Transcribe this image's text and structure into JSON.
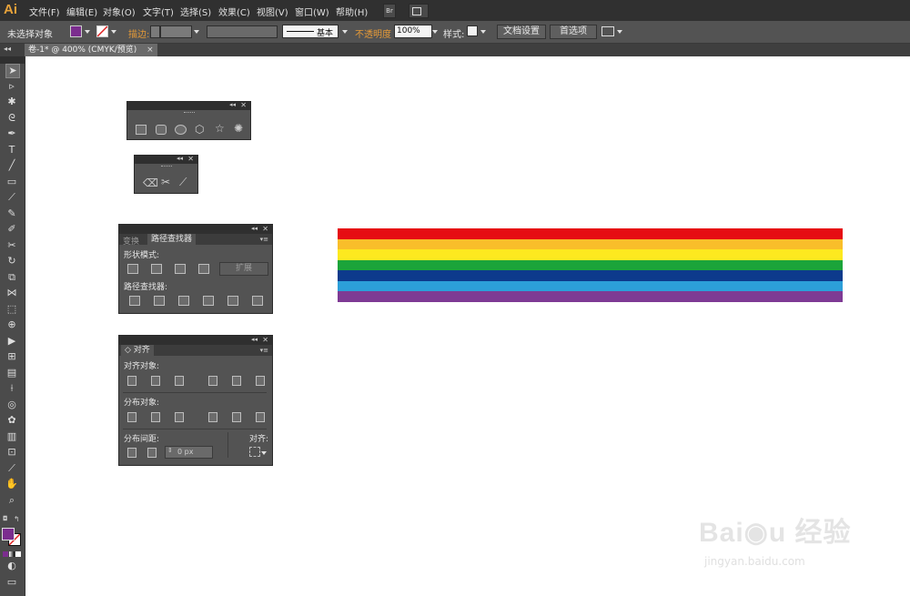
{
  "app": {
    "logo": "Ai"
  },
  "menu": [
    "文件(F)",
    "编辑(E)",
    "对象(O)",
    "文字(T)",
    "选择(S)",
    "效果(C)",
    "视图(V)",
    "窗口(W)",
    "帮助(H)"
  ],
  "menu_buttons": [
    "Br"
  ],
  "control_bar": {
    "selection": "未选择对象",
    "stroke_label": "描边:",
    "stroke_style": "基本",
    "opacity_label": "不透明度",
    "opacity_value": "100%",
    "style_label": "样式:",
    "doc_setup": "文档设置",
    "preferences": "首选项"
  },
  "document_tab": {
    "title": "卷-1* @ 400% (CMYK/预览)",
    "close": "×"
  },
  "colors": {
    "fill": "#7b2d8e",
    "rainbow": [
      "#e60d13",
      "#f9be2a",
      "#fde91f",
      "#1ba43a",
      "#0d3a8c",
      "#2c9fd9",
      "#7e3a94"
    ]
  },
  "shapes_panel": {
    "icons": [
      "rectangle-icon",
      "rounded-rectangle-icon",
      "ellipse-icon",
      "polygon-icon",
      "star-icon",
      "flare-icon"
    ]
  },
  "eraser_panel": {
    "icons": [
      "eraser-icon",
      "scissors-icon",
      "knife-icon"
    ]
  },
  "pathfinder_panel": {
    "tabs": [
      "变换",
      "路径查找器"
    ],
    "shape_modes_label": "形状模式:",
    "expand_label": "扩展",
    "pathfinder_label": "路径查找器:"
  },
  "align_panel": {
    "tab": "对齐",
    "align_objects_label": "对齐对象:",
    "distribute_objects_label": "分布对象:",
    "distribute_spacing_label": "分布间距:",
    "align_to_label": "对齐:",
    "spacing_value": "0 px"
  }
}
